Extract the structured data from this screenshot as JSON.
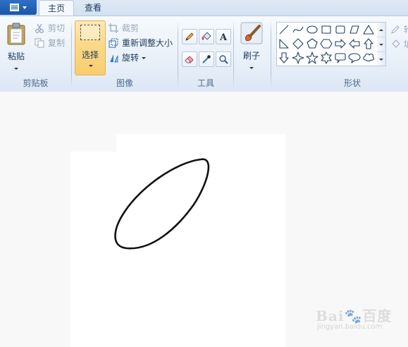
{
  "tabs": [
    {
      "label": "主页",
      "active": true
    },
    {
      "label": "查看",
      "active": false
    }
  ],
  "groups": {
    "clipboard": {
      "label": "剪贴板",
      "paste": "粘贴",
      "cut": "剪切",
      "copy": "复制"
    },
    "image": {
      "label": "图像",
      "select": "选择",
      "crop": "裁剪",
      "resize": "重新调整大小",
      "rotate": "旋转"
    },
    "tools": {
      "label": "工具",
      "items": [
        "pencil-icon",
        "fill-icon",
        "text-icon",
        "eraser-icon",
        "color-picker-icon",
        "magnifier-icon"
      ]
    },
    "brushes": {
      "label": "刷子"
    },
    "shapes": {
      "label": "形状",
      "items": [
        "line",
        "curve",
        "oval",
        "rectangle",
        "rounded-rectangle",
        "polygon",
        "triangle",
        "right-triangle",
        "diamond",
        "pentagon",
        "hexagon",
        "right-arrow",
        "left-arrow",
        "up-arrow",
        "down-arrow",
        "four-point-star",
        "five-point-star",
        "six-point-star",
        "rounded-callout",
        "oval-callout",
        "cloud-callout"
      ]
    },
    "overflow": {
      "outline_partial": "轮",
      "fill_partial": "填"
    }
  },
  "watermark": {
    "brand": "Bai🐾百度",
    "sub": "jingyan.baidu.com"
  },
  "colors": {
    "accent": "#1b56a8",
    "ribbon": "#e5eef8",
    "selected": "#fbd986",
    "stroke": "#111111"
  }
}
